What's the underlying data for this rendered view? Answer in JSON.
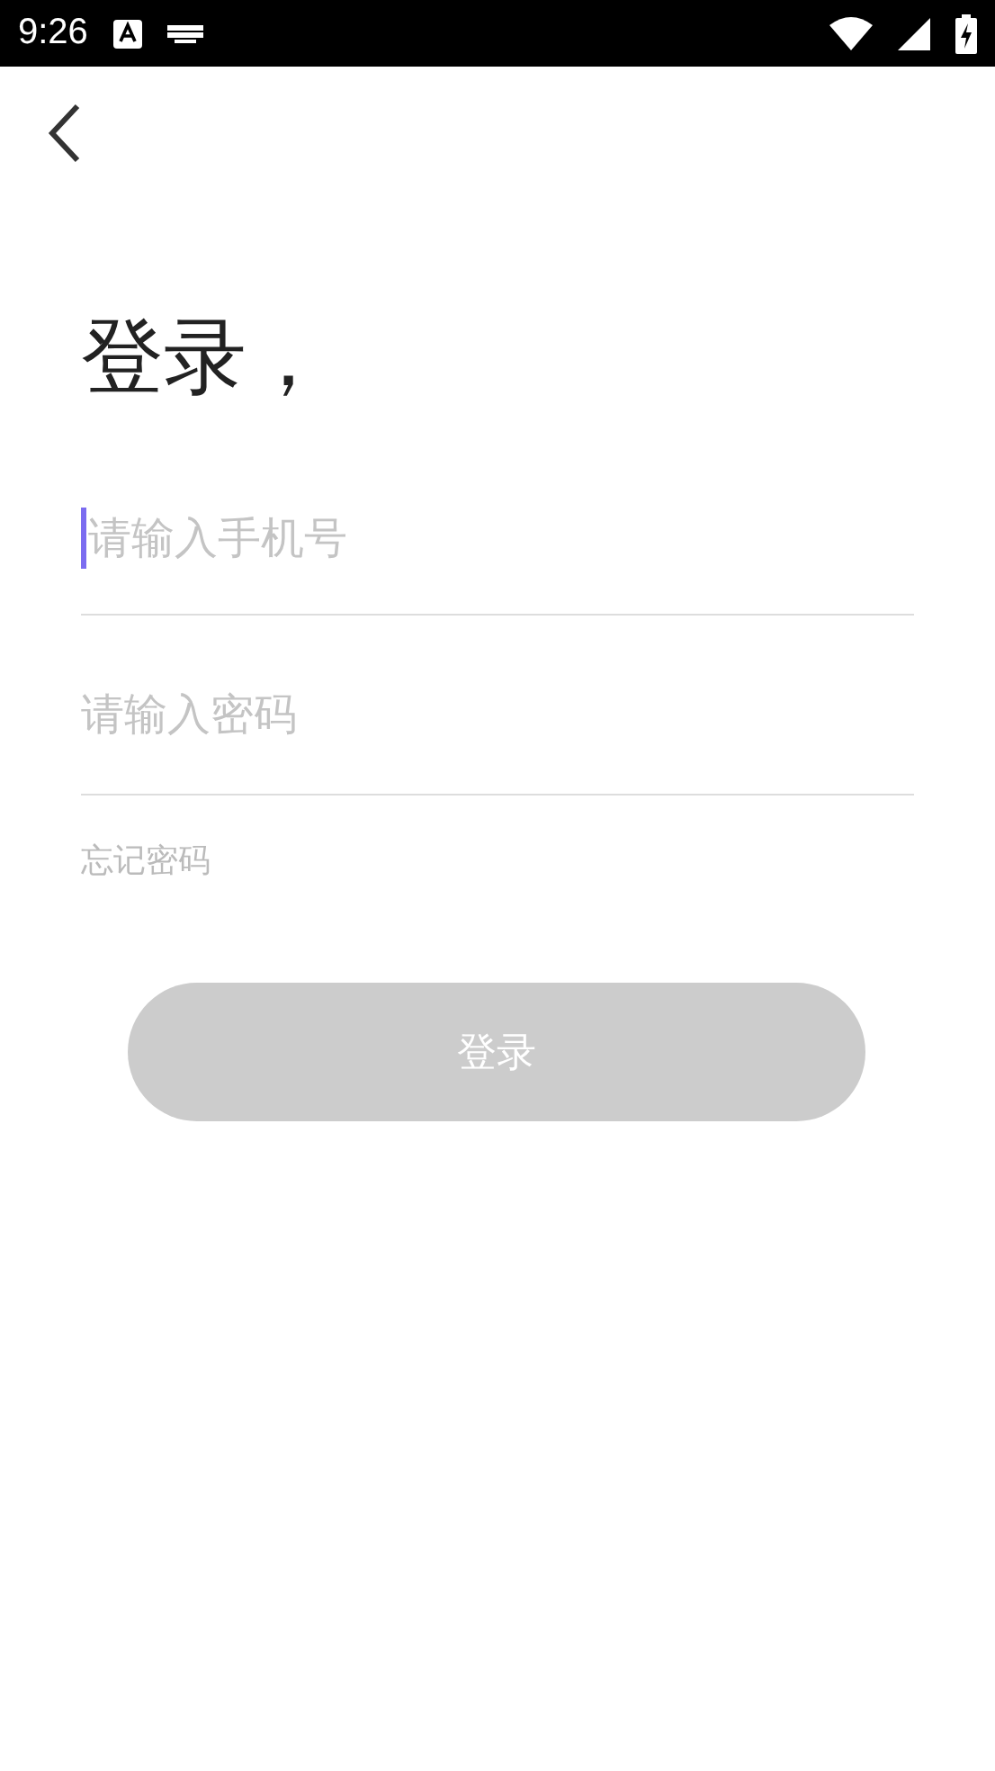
{
  "status_bar": {
    "time": "9:26"
  },
  "title": "登录，",
  "fields": [
    {
      "placeholder": "请输入手机号",
      "focused": true
    },
    {
      "placeholder": "请输入密码",
      "focused": false
    }
  ],
  "forgot_link": "忘记密码",
  "login_button": {
    "label": "登录",
    "disabled": true
  }
}
